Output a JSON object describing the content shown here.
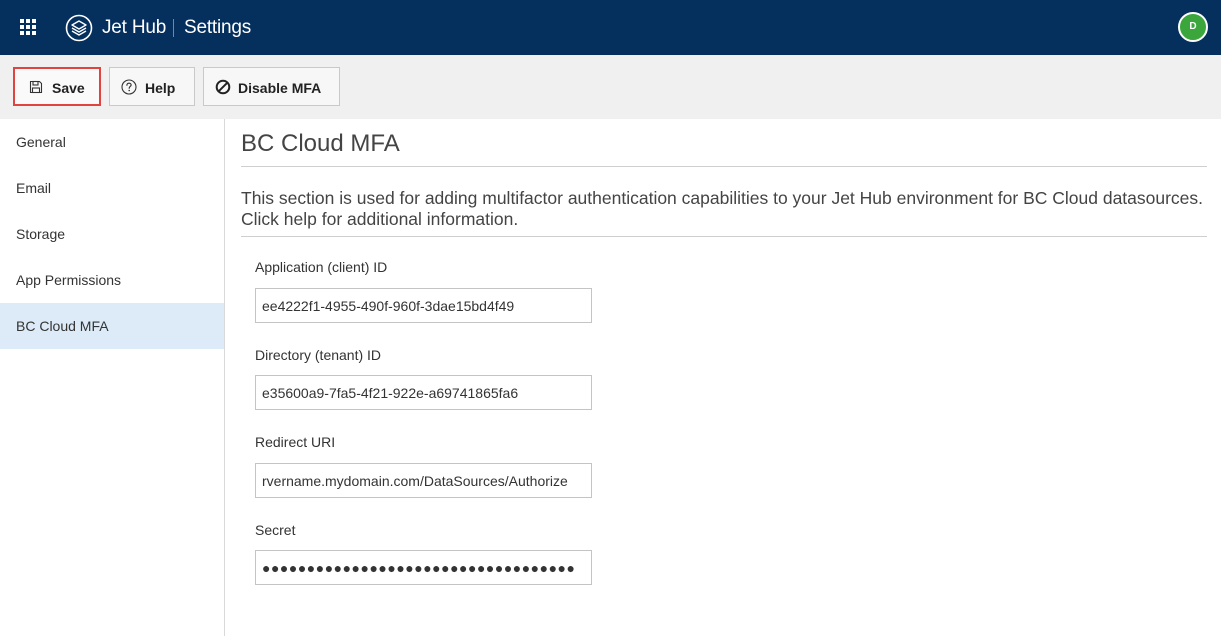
{
  "header": {
    "app_name": "Jet Hub",
    "page_name": "Settings",
    "avatar_initial": "D",
    "colors": {
      "bar": "#05305e",
      "avatar": "#3aa63c"
    }
  },
  "toolbar": {
    "save_label": "Save",
    "help_label": "Help",
    "disable_mfa_label": "Disable MFA"
  },
  "sidebar": {
    "items": [
      {
        "label": "General"
      },
      {
        "label": "Email"
      },
      {
        "label": "Storage"
      },
      {
        "label": "App Permissions"
      },
      {
        "label": "BC Cloud MFA",
        "active": true
      }
    ]
  },
  "main": {
    "title": "BC Cloud MFA",
    "description": "This section is used for adding multifactor authentication capabilities to your Jet Hub environment for BC Cloud datasources. Click help for additional information.",
    "fields": {
      "client_id": {
        "label": "Application (client) ID",
        "value": "ee4222f1-4955-490f-960f-3dae15bd4f49"
      },
      "tenant_id": {
        "label": "Directory (tenant) ID",
        "value": "e35600a9-7fa5-4f21-922e-a69741865fa6"
      },
      "redirect_uri": {
        "label": "Redirect URI",
        "value": "rvername.mydomain.com/DataSources/Authorize"
      },
      "secret": {
        "label": "Secret",
        "value": "●●●●●●●●●●●●●●●●●●●●●●●●●●●●●●●●●●●"
      }
    }
  }
}
